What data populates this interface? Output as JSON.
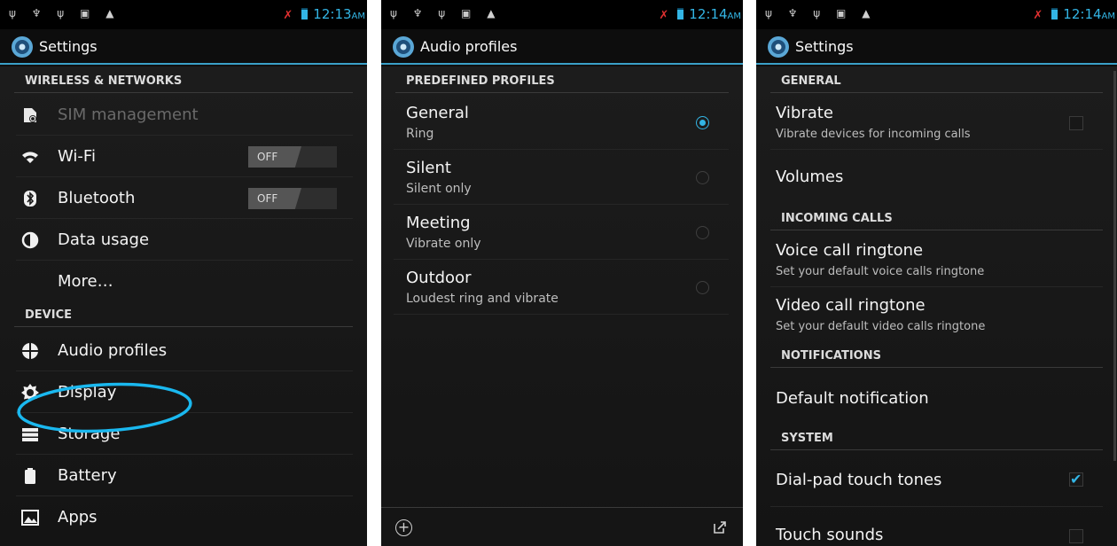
{
  "phone1": {
    "status_time": "12:13",
    "status_ampm": "AM",
    "title": "Settings",
    "sections": {
      "wireless": "WIRELESS & NETWORKS",
      "device": "DEVICE"
    },
    "items": {
      "sim": "SIM management",
      "wifi": "Wi-Fi",
      "bluetooth": "Bluetooth",
      "data": "Data usage",
      "more": "More…",
      "audio": "Audio profiles",
      "display": "Display",
      "storage": "Storage",
      "battery": "Battery",
      "apps": "Apps"
    },
    "wifi_toggle": "OFF",
    "bluetooth_toggle": "OFF"
  },
  "phone2": {
    "status_time": "12:14",
    "status_ampm": "AM",
    "title": "Audio profiles",
    "section": "PREDEFINED PROFILES",
    "profiles": [
      {
        "title": "General",
        "subtitle": "Ring",
        "selected": true
      },
      {
        "title": "Silent",
        "subtitle": "Silent only",
        "selected": false
      },
      {
        "title": "Meeting",
        "subtitle": "Vibrate only",
        "selected": false
      },
      {
        "title": "Outdoor",
        "subtitle": "Loudest ring and vibrate",
        "selected": false
      }
    ]
  },
  "phone3": {
    "status_time": "12:14",
    "status_ampm": "AM",
    "title": "Settings",
    "sections": {
      "general": "GENERAL",
      "incoming": "INCOMING CALLS",
      "notifications": "NOTIFICATIONS",
      "system": "SYSTEM"
    },
    "vibrate_title": "Vibrate",
    "vibrate_sub": "Vibrate devices for incoming calls",
    "volumes": "Volumes",
    "voice_title": "Voice call ringtone",
    "voice_sub": "Set your default voice calls ringtone",
    "video_title": "Video call ringtone",
    "video_sub": "Set your default video calls ringtone",
    "default_notification": "Default notification",
    "dialpad": "Dial-pad touch tones",
    "touch_sounds": "Touch sounds",
    "checked": {
      "vibrate": false,
      "dialpad": true,
      "touch_sounds": false
    }
  },
  "colors": {
    "accent": "#33b5e5",
    "annotation": "#1ab8ef"
  }
}
